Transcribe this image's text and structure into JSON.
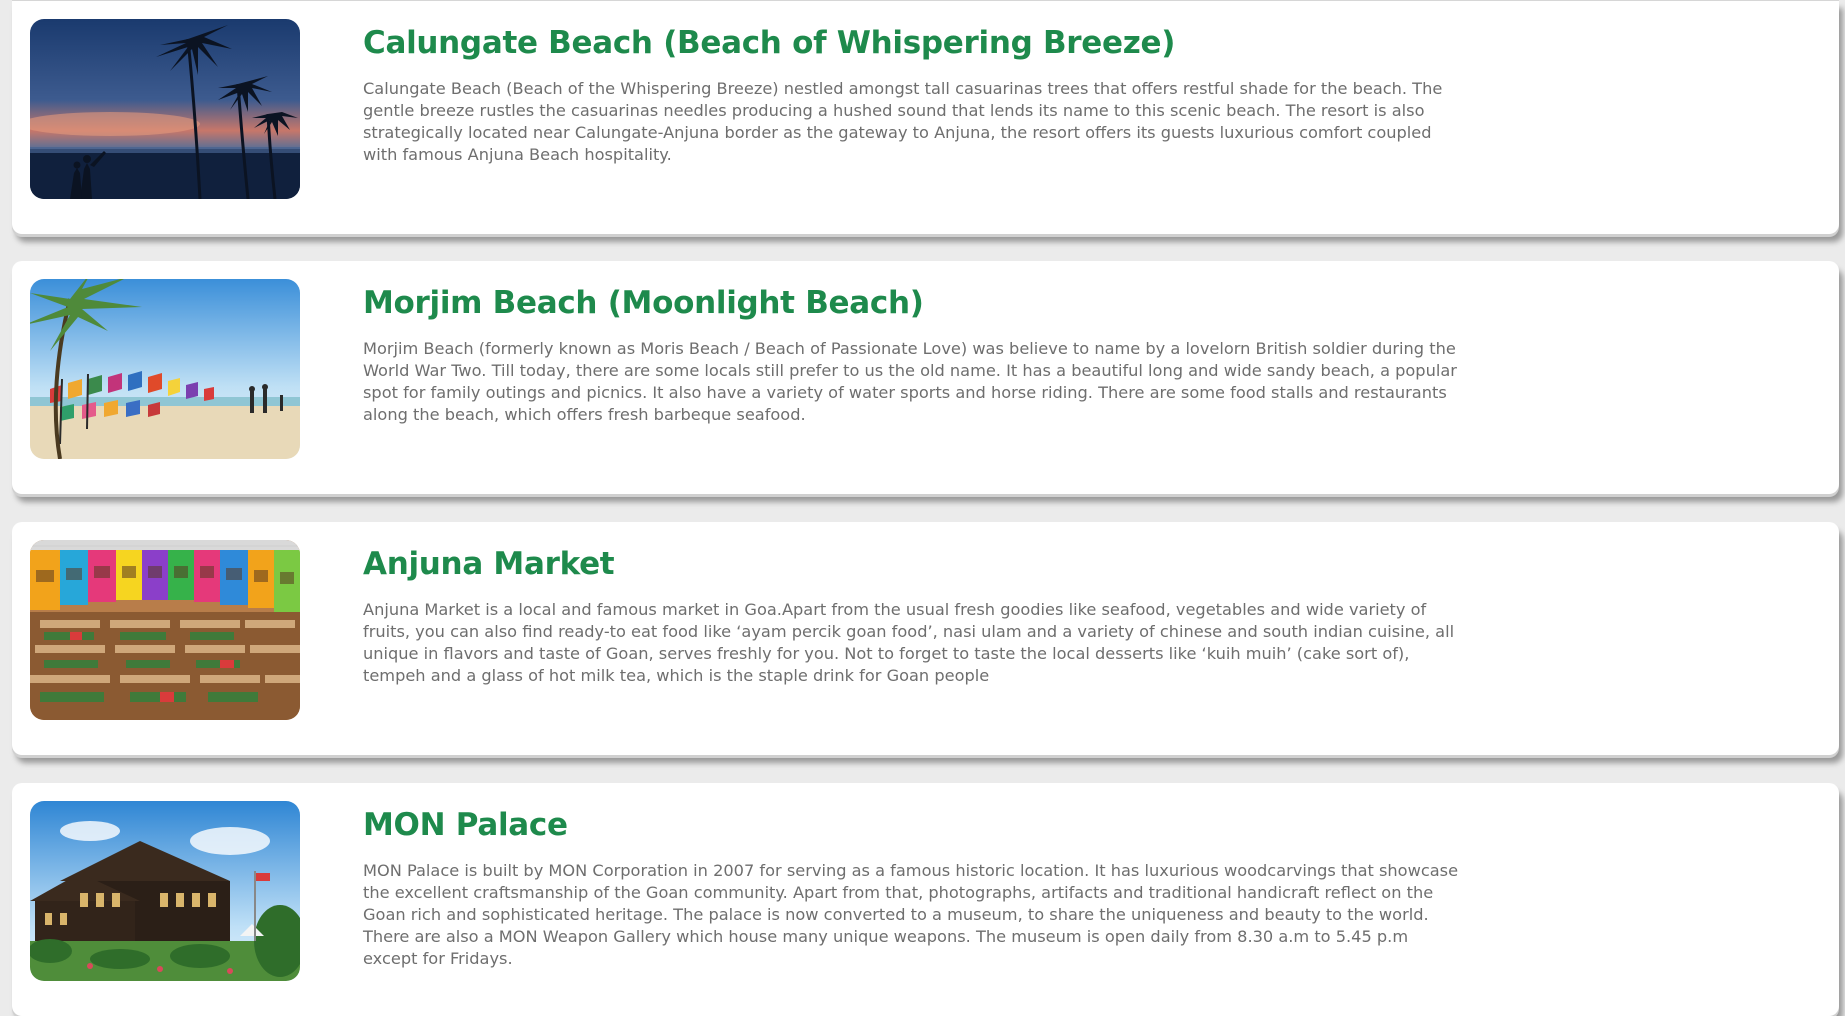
{
  "attractions": [
    {
      "title": "Calungate Beach (Beach of Whispering Breeze)",
      "description": "Calungate Beach (Beach of the Whispering Breeze) nestled amongst tall casuarinas trees that offers restful shade for the beach. The gentle breeze rustles the casuarinas needles producing a hushed sound that lends its name to this scenic beach. The resort is also strategically located near Calungate-Anjuna border as the gateway to Anjuna, the resort offers its guests luxurious comfort coupled with famous Anjuna Beach hospitality.",
      "image": "sunset-beach-palms-photo"
    },
    {
      "title": "Morjim Beach (Moonlight Beach)",
      "description": "Morjim Beach (formerly known as Moris Beach / Beach of Passionate Love) was believe to name by a lovelorn British soldier during the World War Two. Till today, there are some locals still prefer to us the old name. It has a beautiful long and wide sandy beach, a popular spot for family outings and picnics. It also have a variety of water sports and horse riding. There are some food stalls and restaurants along the beach, which offers fresh barbeque seafood.",
      "image": "beach-kites-palm-photo"
    },
    {
      "title": "Anjuna Market",
      "description": "Anjuna Market is a local and famous market in Goa.Apart from the usual fresh goodies like seafood, vegetables and wide variety of fruits, you can also find ready-to eat food like ‘ayam percik goan food’, nasi ulam and a variety of chinese and south indian cuisine, all unique in flavors and taste of Goan, serves freshly for you. Not to forget to taste the local desserts like ‘kuih muih’ (cake sort of), tempeh and a glass of hot milk tea, which is the staple drink for Goan people",
      "image": "colorful-market-hall-photo"
    },
    {
      "title": "MON Palace",
      "description": "MON Palace is built by MON Corporation in 2007 for serving as a famous historic location. It has luxurious woodcarvings that showcase the excellent craftsmanship of the Goan community. Apart from that, photographs, artifacts and traditional handicraft reflect on the Goan rich and sophisticated heritage. The palace is now converted to a museum, to share the uniqueness and beauty to the world. There are also a MON Weapon Gallery which house many unique weapons. The museum is open daily from 8.30 a.m to 5.45 p.m except for Fridays.",
      "image": "wooden-palace-photo"
    }
  ],
  "colors": {
    "title": "#1e8a4c",
    "body_text": "#6e6e6e",
    "page_background": "#ebebeb",
    "card_background": "#ffffff"
  }
}
